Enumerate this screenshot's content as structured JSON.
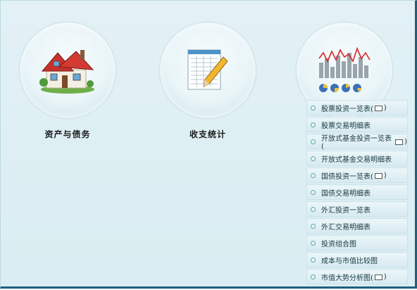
{
  "modules": [
    {
      "label": "资产与债务",
      "icon": "house-icon"
    },
    {
      "label": "收支统计",
      "icon": "notepad-pencil-icon"
    },
    {
      "label": "",
      "icon": "stock-chart-icon"
    }
  ],
  "menu": {
    "items": [
      {
        "before": "股票投资一览表(",
        "after": ")",
        "has_mail": true
      },
      {
        "before": "股票交易明细表",
        "after": "",
        "has_mail": false
      },
      {
        "before": "开放式基金投资一览表(",
        "after": ")",
        "has_mail": true
      },
      {
        "before": "开放式基金交易明细表",
        "after": "",
        "has_mail": false
      },
      {
        "before": "国债投资一览表(",
        "after": ")",
        "has_mail": true
      },
      {
        "before": "国债交易明细表",
        "after": "",
        "has_mail": false
      },
      {
        "before": "外汇投资一览表",
        "after": "",
        "has_mail": false
      },
      {
        "before": "外汇交易明细表",
        "after": "",
        "has_mail": false
      },
      {
        "before": "投资组合图",
        "after": "",
        "has_mail": false
      },
      {
        "before": "成本与市值比较图",
        "after": "",
        "has_mail": false
      },
      {
        "before": "市值大势分析图(",
        "after": ")",
        "has_mail": true
      }
    ]
  },
  "colors": {
    "background": "#dcedf2",
    "frame_border": "#1e5f7e",
    "menu_bullet": "#5aa9a4"
  }
}
